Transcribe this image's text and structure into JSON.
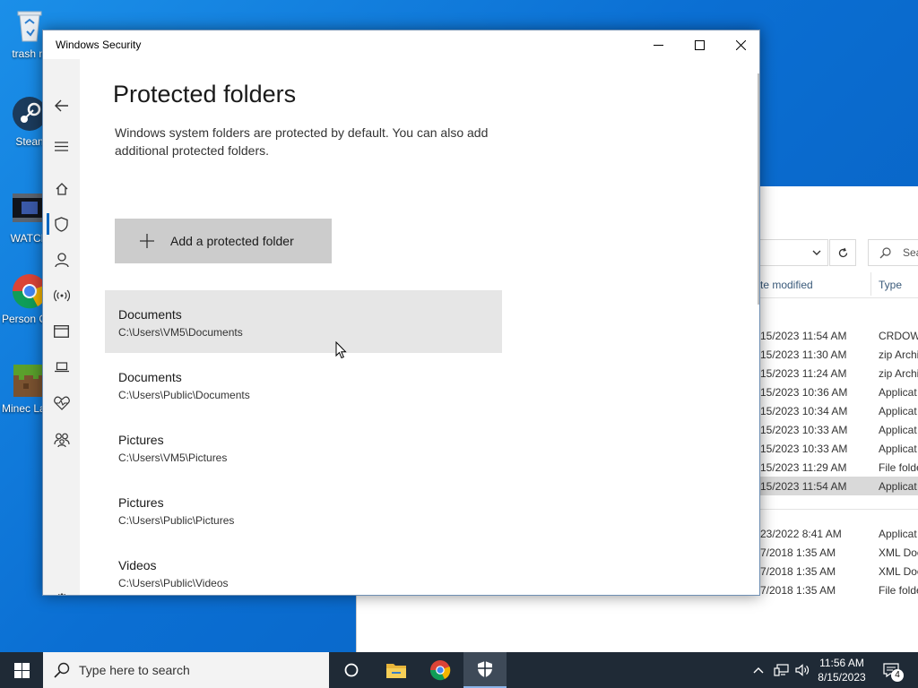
{
  "desktop": {
    "icons": [
      {
        "label": "trash ni"
      },
      {
        "label": "Stean"
      },
      {
        "label": "WATCH"
      },
      {
        "label": "Person Chron"
      },
      {
        "label": "Minec Launc"
      }
    ]
  },
  "explorer": {
    "col_date": "te modified",
    "col_type": "Type",
    "search_placeholder": "Sea",
    "rows": [
      {
        "date": "15/2023 11:54 AM",
        "type": "CRDOWI"
      },
      {
        "date": "15/2023 11:30 AM",
        "type": "zip Archi"
      },
      {
        "date": "15/2023 11:24 AM",
        "type": "zip Archi"
      },
      {
        "date": "15/2023 10:36 AM",
        "type": "Applicat"
      },
      {
        "date": "15/2023 10:34 AM",
        "type": "Applicat"
      },
      {
        "date": "15/2023 10:33 AM",
        "type": "Applicat"
      },
      {
        "date": "15/2023 10:33 AM",
        "type": "Applicat"
      },
      {
        "date": "15/2023 11:29 AM",
        "type": "File folde"
      },
      {
        "date": "15/2023 11:54 AM",
        "type": "Applicat"
      },
      {
        "date": "23/2022 8:41 AM",
        "type": "Applicat"
      },
      {
        "date": "7/2018 1:35 AM",
        "type": "XML Doc"
      },
      {
        "date": "7/2018 1:35 AM",
        "type": "XML Doc"
      },
      {
        "date": "7/2018 1:35 AM",
        "type": "File folde"
      }
    ]
  },
  "window": {
    "title": "Windows Security",
    "heading": "Protected folders",
    "description": "Windows system folders are protected by default. You can also add additional protected folders.",
    "add_button": "Add a protected folder",
    "folders": [
      {
        "name": "Documents",
        "path": "C:\\Users\\VM5\\Documents"
      },
      {
        "name": "Documents",
        "path": "C:\\Users\\Public\\Documents"
      },
      {
        "name": "Pictures",
        "path": "C:\\Users\\VM5\\Pictures"
      },
      {
        "name": "Pictures",
        "path": "C:\\Users\\Public\\Pictures"
      },
      {
        "name": "Videos",
        "path": "C:\\Users\\Public\\Videos"
      }
    ],
    "nav_icons": [
      "back-icon",
      "menu-icon",
      "home-icon",
      "shield-icon",
      "account-icon",
      "firewall-icon",
      "app-browser-icon",
      "device-icon",
      "health-icon",
      "family-icon",
      "settings-icon"
    ]
  },
  "taskbar": {
    "search_placeholder": "Type here to search",
    "time": "11:56 AM",
    "date": "8/15/2023",
    "notification_count": "4"
  },
  "colors": {
    "accent": "#0067c0",
    "nav_bg": "#f2f2f2",
    "button_bg": "#cccccc",
    "hover_bg": "#e6e6e6",
    "taskbar_bg": "#1f2a36"
  }
}
